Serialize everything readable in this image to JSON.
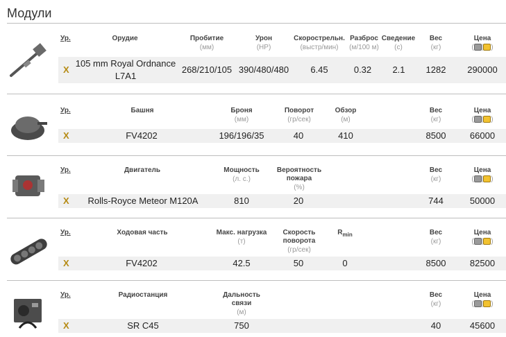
{
  "title": "Модули",
  "common": {
    "level_header": "Ур.",
    "level_value": "X",
    "weight_header": "Вес",
    "weight_unit": "(кг)",
    "price_header": "Цена"
  },
  "gun": {
    "name_header": "Орудие",
    "pen_header": "Пробитие",
    "pen_unit": "(мм)",
    "dmg_header": "Урон",
    "dmg_unit": "(HP)",
    "rof_header": "Скорострельн.",
    "rof_unit": "(выстр/мин)",
    "disp_header": "Разброс",
    "disp_unit": "(м/100 м)",
    "aim_header": "Сведение",
    "aim_unit": "(с)",
    "name_line1": "105 mm Royal Ordnance",
    "name_line2": "L7A1",
    "pen": "268/210/105",
    "dmg": "390/480/480",
    "rof": "6.45",
    "disp": "0.32",
    "aim": "2.1",
    "weight": "1282",
    "price": "290000"
  },
  "turret": {
    "name_header": "Башня",
    "armor_header": "Броня",
    "armor_unit": "(мм)",
    "traverse_header": "Поворот",
    "traverse_unit": "(гр/сек)",
    "view_header": "Обзор",
    "view_unit": "(м)",
    "name": "FV4202",
    "armor": "196/196/35",
    "traverse": "40",
    "view": "410",
    "weight": "8500",
    "price": "66000"
  },
  "engine": {
    "name_header": "Двигатель",
    "power_header": "Мощность",
    "power_unit": "(л. с.)",
    "fire_header_1": "Вероятность",
    "fire_header_2": "пожара",
    "fire_unit": "(%)",
    "name": "Rolls-Royce Meteor M120A",
    "power": "810",
    "fire": "20",
    "weight": "744",
    "price": "50000"
  },
  "suspension": {
    "name_header": "Ходовая часть",
    "load_header": "Макс. нагрузка",
    "load_unit": "(т)",
    "speed_header_1": "Скорость",
    "speed_header_2": "поворота",
    "speed_unit": "(гр/сек)",
    "rmin_header": "R",
    "rmin_sub": "min",
    "name": "FV4202",
    "load": "42.5",
    "speed": "50",
    "rmin": "0",
    "weight": "8500",
    "price": "82500"
  },
  "radio": {
    "name_header": "Радиостанция",
    "range_header_1": "Дальность",
    "range_header_2": "связи",
    "range_unit": "(м)",
    "name": "SR C45",
    "range": "750",
    "weight": "40",
    "price": "45600"
  }
}
